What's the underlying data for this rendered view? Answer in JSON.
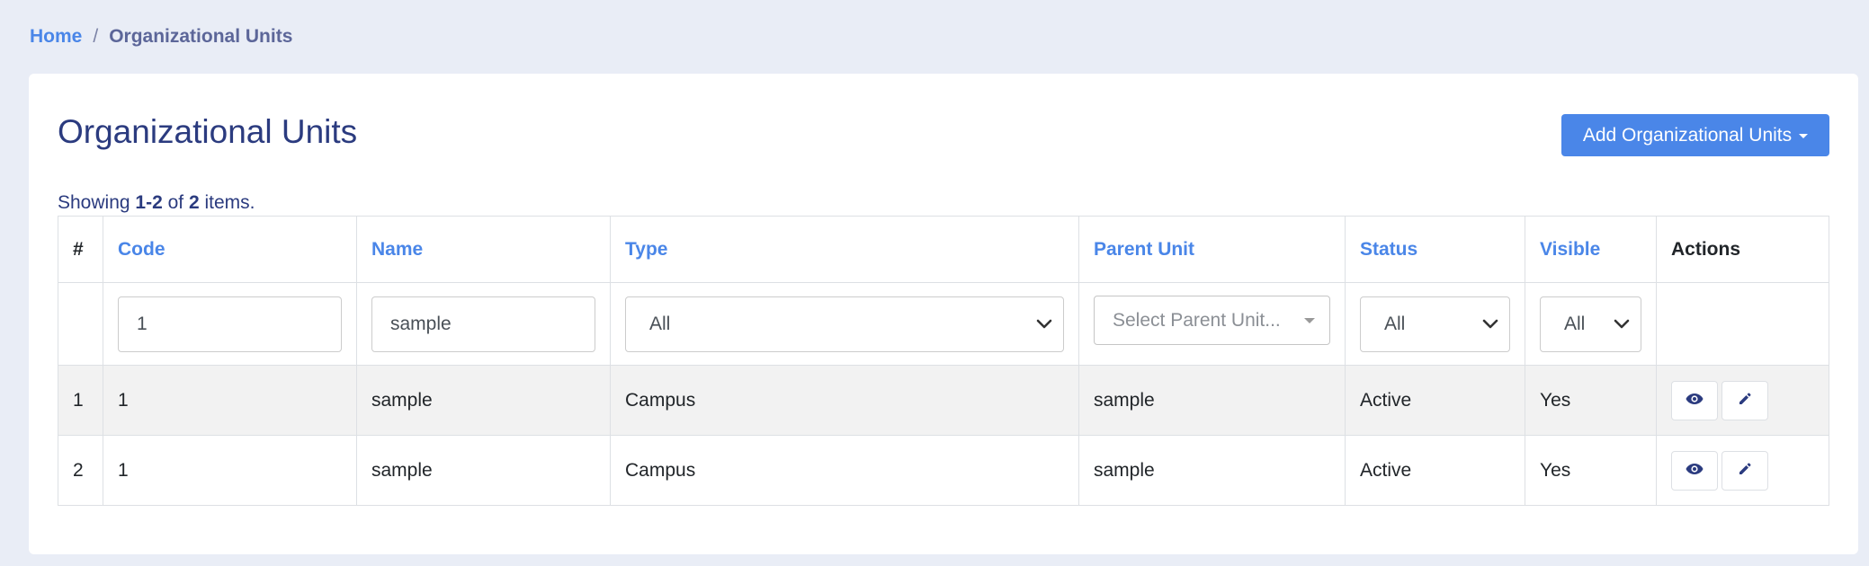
{
  "breadcrumb": {
    "home": "Home",
    "separator": "/",
    "current": "Organizational Units"
  },
  "page": {
    "title": "Organizational Units",
    "add_button": "Add Organizational Units"
  },
  "summary": {
    "prefix": "Showing",
    "range": "1-2",
    "of": "of",
    "total": "2",
    "suffix": "items."
  },
  "table": {
    "headers": {
      "index": "#",
      "code": "Code",
      "name": "Name",
      "type": "Type",
      "parent": "Parent Unit",
      "status": "Status",
      "visible": "Visible",
      "actions": "Actions"
    },
    "filters": {
      "code": "1",
      "name": "sample",
      "type": "All",
      "parent_placeholder": "Select Parent Unit...",
      "status": "All",
      "visible": "All"
    },
    "rows": [
      {
        "index": "1",
        "code": "1",
        "name": "sample",
        "type": "Campus",
        "parent": "sample",
        "status": "Active",
        "visible": "Yes"
      },
      {
        "index": "2",
        "code": "1",
        "name": "sample",
        "type": "Campus",
        "parent": "sample",
        "status": "Active",
        "visible": "Yes"
      }
    ]
  },
  "icons": {
    "view": "eye-icon",
    "edit": "pencil-icon"
  },
  "colors": {
    "accent": "#4a86e8",
    "title": "#2b3b7f",
    "background": "#e9edf6"
  }
}
